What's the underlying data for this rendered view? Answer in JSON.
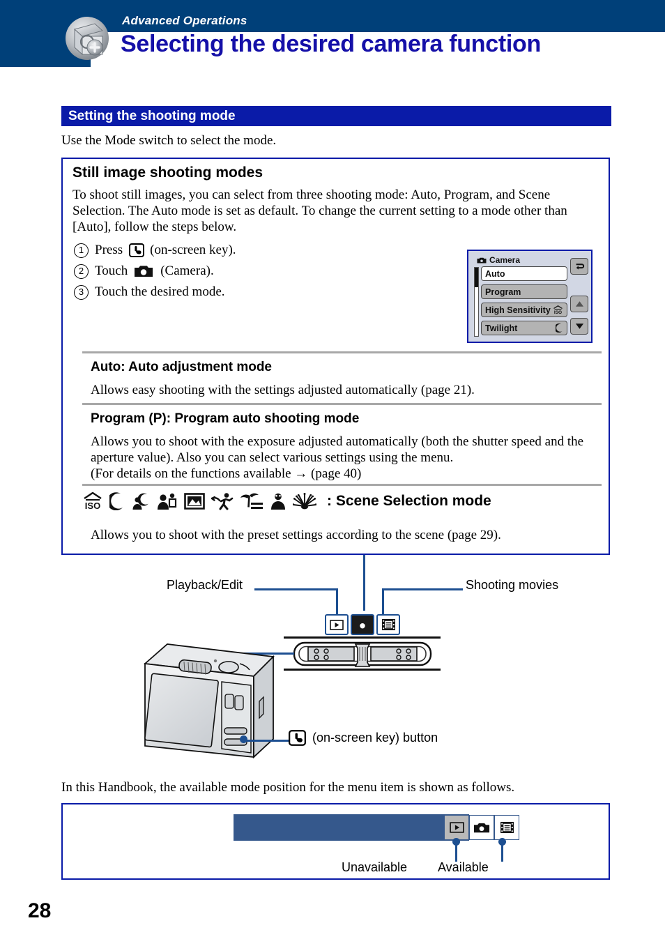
{
  "header": {
    "kicker": "Advanced Operations",
    "title": "Selecting the desired camera function",
    "icon": "camera-plus-icon",
    "band_color": "#004079",
    "title_color": "#1510a8"
  },
  "section": {
    "bar_title": "Setting the shooting mode",
    "bar_color": "#0a1ba8",
    "lead": "Use the Mode switch to select the mode."
  },
  "main_box": {
    "title": "Still image shooting modes",
    "paragraph": "To shoot still images, you can select from three shooting mode: Auto, Program, and Scene Selection. The Auto mode is set as default. To change the current setting to a mode other than [Auto], follow the steps below.",
    "steps": [
      {
        "num": "1",
        "before": "Press",
        "icon": "on-screen-key-icon",
        "after": "(on-screen key)."
      },
      {
        "num": "2",
        "before": "Touch",
        "icon": "camera-icon",
        "after": "(Camera)."
      },
      {
        "num": "3",
        "before": "Touch the desired mode.",
        "icon": "",
        "after": ""
      }
    ],
    "modes": [
      {
        "heading": "Auto: Auto adjustment mode",
        "text": "Allows easy shooting with the settings adjusted automatically (page 21)."
      },
      {
        "heading": "Program (P): Program auto shooting mode",
        "text": "Allows you to shoot with the exposure adjusted automatically (both the shutter speed and the aperture value). Also you can select various settings using the menu.\n(For details on the functions available → (page 40)"
      }
    ],
    "scene": {
      "icons": [
        "iso-high-sensitivity-icon",
        "twilight-moon-icon",
        "twilight-portrait-icon",
        "soft-snap-icon",
        "landscape-icon",
        "high-speed-shutter-icon",
        "beach-icon",
        "snow-icon",
        "fireworks-icon"
      ],
      "label": ": Scene Selection mode",
      "text": "Allows you to shoot with the preset settings according to the scene (page 29)."
    }
  },
  "lcd": {
    "title": "Camera",
    "title_icon": "camera-icon",
    "options": [
      {
        "label": "Auto",
        "state": "selected",
        "icon": ""
      },
      {
        "label": "Program",
        "state": "normal",
        "icon": ""
      },
      {
        "label": "High Sensitivity",
        "state": "normal",
        "icon": "iso-icon"
      },
      {
        "label": "Twilight",
        "state": "normal",
        "icon": "moon-icon"
      }
    ],
    "buttons": [
      {
        "name": "back-button",
        "icon": "return-arrow-icon"
      },
      {
        "name": "scroll-up-button",
        "icon": "triangle-up-icon"
      },
      {
        "name": "scroll-down-button",
        "icon": "triangle-down-icon"
      }
    ]
  },
  "diagram": {
    "callout_left": "Playback/Edit",
    "callout_right": "Shooting movies",
    "mode_icons": [
      {
        "name": "playback-mode-icon",
        "state": "normal"
      },
      {
        "name": "still-camera-mode-icon",
        "state": "active"
      },
      {
        "name": "movie-mode-icon",
        "state": "normal"
      }
    ],
    "onscreen_key_caption": "(on-screen key) button",
    "onscreen_key_icon": "on-screen-key-icon",
    "camera_illustration": "camera-rear-view-illustration",
    "mode_switch_detail": "mode-switch-enlarged-illustration"
  },
  "legend": {
    "lead": "In this Handbook, the available mode position for the menu item is shown as follows.",
    "bar_color": "#35588c",
    "icons": [
      {
        "name": "playback-mode-icon",
        "state": "unavailable"
      },
      {
        "name": "still-camera-mode-icon",
        "state": "available"
      },
      {
        "name": "movie-mode-icon",
        "state": "available"
      }
    ],
    "caption_unavailable": "Unavailable",
    "caption_available": "Available"
  },
  "page_number": "28"
}
